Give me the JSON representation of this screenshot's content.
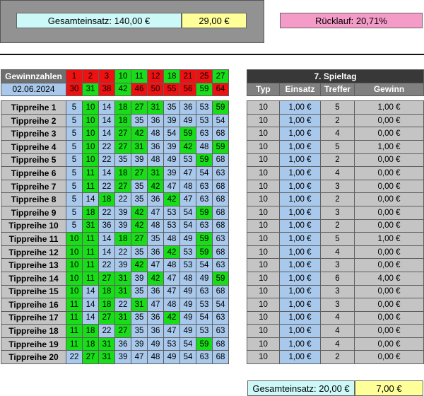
{
  "summary": {
    "total_stake": "Gesamteinsatz: 140,00 €",
    "total_win": "29,00 €",
    "return_rate": "Rücklauf: 20,71%"
  },
  "draw": {
    "header_label": "Gewinnzahlen",
    "date": "02.06.2024",
    "numbers": [
      1,
      2,
      3,
      10,
      11,
      12,
      18,
      21,
      25,
      27,
      30,
      31,
      38,
      42,
      46,
      50,
      55,
      56,
      59,
      64
    ],
    "value_hits": [
      10,
      11,
      18,
      27,
      31,
      42,
      59
    ]
  },
  "matchday": {
    "title": "7. Spieltag",
    "columns": [
      "Typ",
      "Einsatz",
      "Treffer",
      "Gewinn"
    ]
  },
  "rows": [
    {
      "label": "Tippreihe 1",
      "numbers": [
        5,
        10,
        14,
        18,
        27,
        31,
        35,
        36,
        53,
        59
      ],
      "typ": "10",
      "stake": "1,00 €",
      "hits": "5",
      "win": "1,00 €"
    },
    {
      "label": "Tippreihe 2",
      "numbers": [
        5,
        10,
        14,
        18,
        35,
        36,
        39,
        49,
        53,
        54
      ],
      "typ": "10",
      "stake": "1,00 €",
      "hits": "2",
      "win": "0,00 €"
    },
    {
      "label": "Tippreihe 3",
      "numbers": [
        5,
        10,
        14,
        27,
        42,
        48,
        54,
        59,
        63,
        68
      ],
      "typ": "10",
      "stake": "1,00 €",
      "hits": "4",
      "win": "0,00 €"
    },
    {
      "label": "Tippreihe 4",
      "numbers": [
        5,
        10,
        22,
        27,
        31,
        36,
        39,
        42,
        48,
        59
      ],
      "typ": "10",
      "stake": "1,00 €",
      "hits": "5",
      "win": "1,00 €"
    },
    {
      "label": "Tippreihe 5",
      "numbers": [
        5,
        10,
        22,
        35,
        39,
        48,
        49,
        53,
        59,
        68
      ],
      "typ": "10",
      "stake": "1,00 €",
      "hits": "2",
      "win": "0,00 €"
    },
    {
      "label": "Tippreihe 6",
      "numbers": [
        5,
        11,
        14,
        18,
        27,
        31,
        39,
        47,
        54,
        63
      ],
      "typ": "10",
      "stake": "1,00 €",
      "hits": "4",
      "win": "0,00 €"
    },
    {
      "label": "Tippreihe 7",
      "numbers": [
        5,
        11,
        22,
        27,
        35,
        42,
        47,
        48,
        63,
        68
      ],
      "typ": "10",
      "stake": "1,00 €",
      "hits": "3",
      "win": "0,00 €"
    },
    {
      "label": "Tippreihe 8",
      "numbers": [
        5,
        14,
        18,
        22,
        35,
        36,
        42,
        47,
        63,
        68
      ],
      "typ": "10",
      "stake": "1,00 €",
      "hits": "2",
      "win": "0,00 €"
    },
    {
      "label": "Tippreihe 9",
      "numbers": [
        5,
        18,
        22,
        39,
        42,
        47,
        53,
        54,
        59,
        68
      ],
      "typ": "10",
      "stake": "1,00 €",
      "hits": "3",
      "win": "0,00 €"
    },
    {
      "label": "Tippreihe 10",
      "numbers": [
        5,
        31,
        36,
        39,
        42,
        48,
        53,
        54,
        63,
        68
      ],
      "typ": "10",
      "stake": "1,00 €",
      "hits": "2",
      "win": "0,00 €"
    },
    {
      "label": "Tippreihe 11",
      "numbers": [
        10,
        11,
        14,
        18,
        27,
        35,
        48,
        49,
        59,
        63
      ],
      "typ": "10",
      "stake": "1,00 €",
      "hits": "5",
      "win": "1,00 €"
    },
    {
      "label": "Tippreihe 12",
      "numbers": [
        10,
        11,
        14,
        22,
        35,
        36,
        42,
        53,
        59,
        68
      ],
      "typ": "10",
      "stake": "1,00 €",
      "hits": "4",
      "win": "0,00 €"
    },
    {
      "label": "Tippreihe 13",
      "numbers": [
        10,
        11,
        22,
        39,
        42,
        47,
        48,
        53,
        54,
        63
      ],
      "typ": "10",
      "stake": "1,00 €",
      "hits": "3",
      "win": "0,00 €"
    },
    {
      "label": "Tippreihe 14",
      "numbers": [
        10,
        11,
        27,
        31,
        39,
        42,
        47,
        48,
        49,
        59
      ],
      "typ": "10",
      "stake": "1,00 €",
      "hits": "6",
      "win": "4,00 €"
    },
    {
      "label": "Tippreihe 15",
      "numbers": [
        10,
        14,
        18,
        31,
        35,
        36,
        47,
        49,
        63,
        68
      ],
      "typ": "10",
      "stake": "1,00 €",
      "hits": "3",
      "win": "0,00 €"
    },
    {
      "label": "Tippreihe 16",
      "numbers": [
        11,
        14,
        18,
        22,
        31,
        47,
        48,
        49,
        53,
        54
      ],
      "typ": "10",
      "stake": "1,00 €",
      "hits": "3",
      "win": "0,00 €"
    },
    {
      "label": "Tippreihe 17",
      "numbers": [
        11,
        14,
        27,
        31,
        35,
        36,
        42,
        49,
        54,
        63
      ],
      "typ": "10",
      "stake": "1,00 €",
      "hits": "4",
      "win": "0,00 €"
    },
    {
      "label": "Tippreihe 18",
      "numbers": [
        11,
        18,
        22,
        27,
        35,
        36,
        47,
        49,
        53,
        63
      ],
      "typ": "10",
      "stake": "1,00 €",
      "hits": "4",
      "win": "0,00 €"
    },
    {
      "label": "Tippreihe 19",
      "numbers": [
        11,
        18,
        31,
        36,
        39,
        49,
        53,
        54,
        59,
        68
      ],
      "typ": "10",
      "stake": "1,00 €",
      "hits": "4",
      "win": "0,00 €"
    },
    {
      "label": "Tippreihe 20",
      "numbers": [
        22,
        27,
        31,
        39,
        47,
        48,
        49,
        54,
        63,
        68
      ],
      "typ": "10",
      "stake": "1,00 €",
      "hits": "2",
      "win": "0,00 €"
    }
  ],
  "footer": {
    "total_stake": "Gesamteinsatz: 20,00 €",
    "total_win": "7,00 €"
  },
  "colors": {
    "hit_green": "#18dd18",
    "drawn_red": "#ee1111",
    "pick_blue": "#a8c8ec",
    "stake_cyan": "#ccf8f8",
    "win_yellow": "#ffff99",
    "return_pink": "#f59bc8"
  }
}
